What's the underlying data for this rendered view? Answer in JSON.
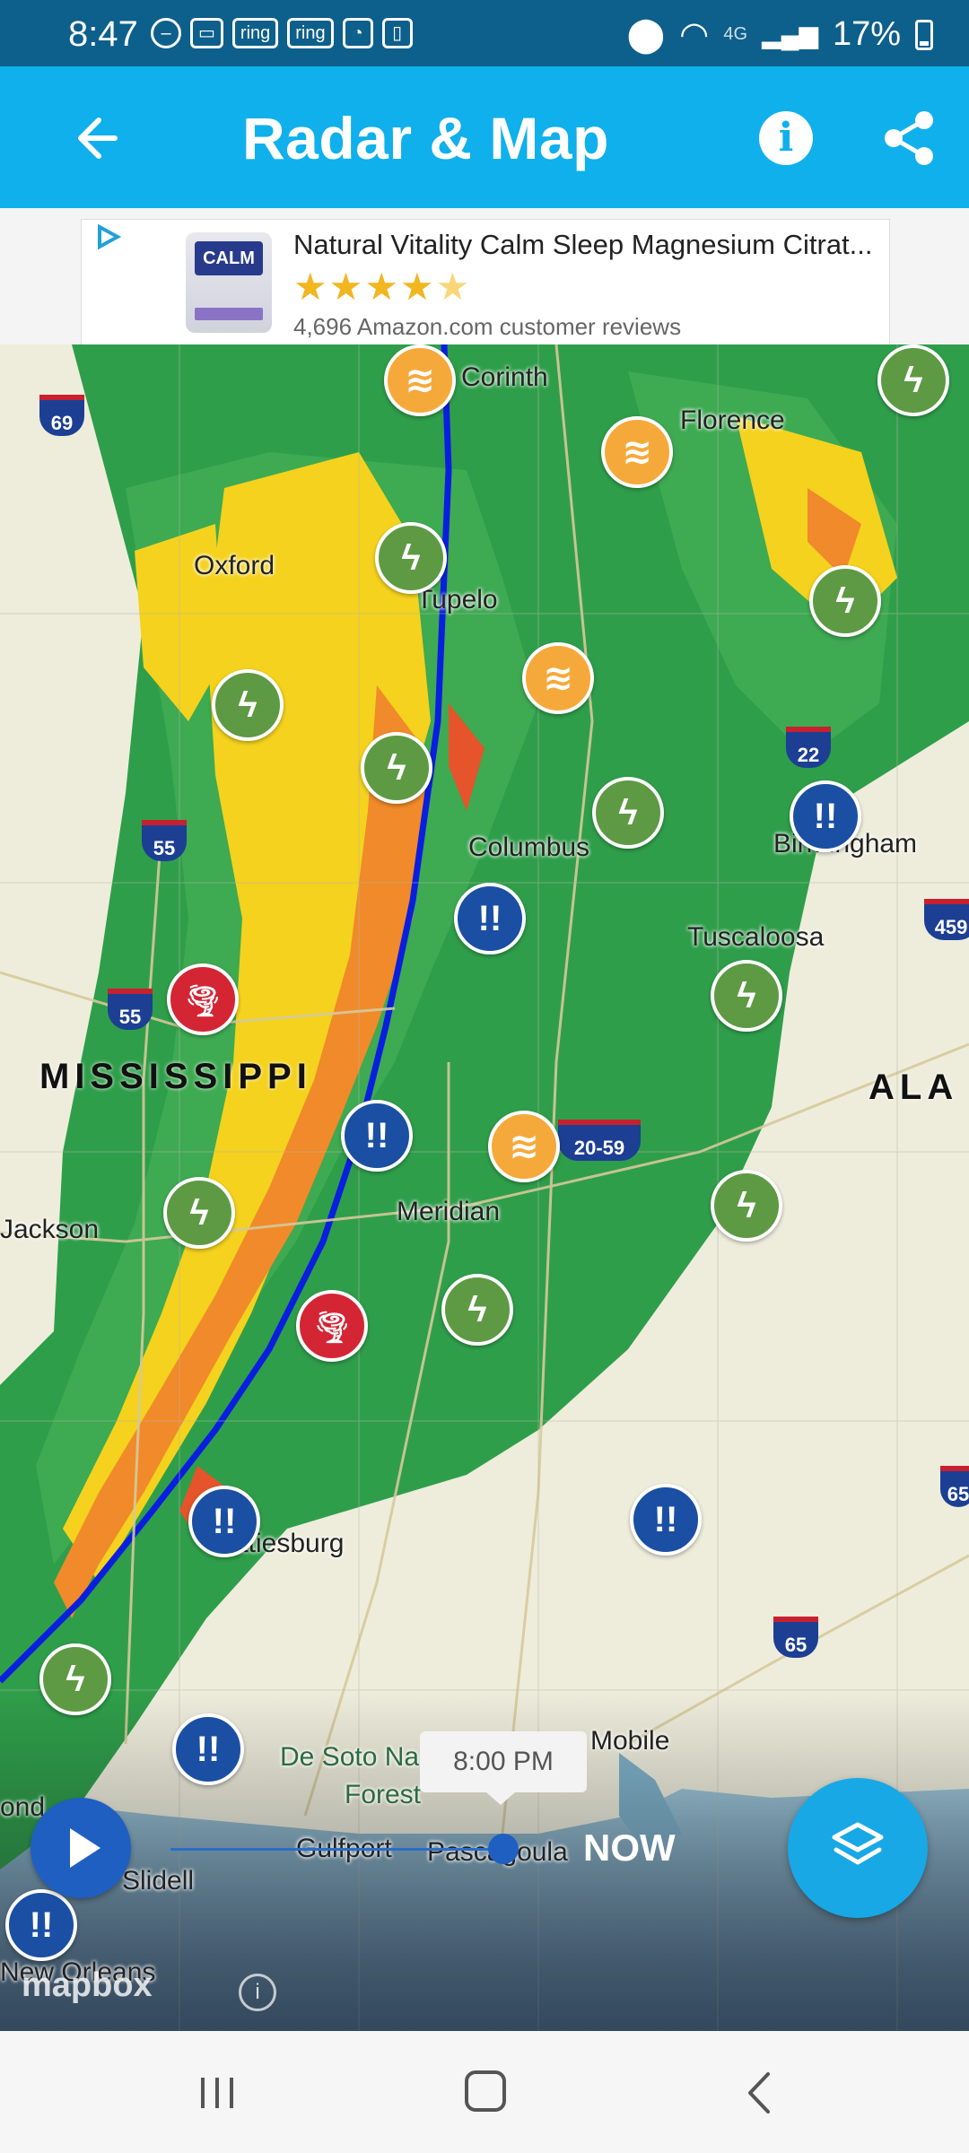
{
  "status_bar": {
    "time": "8:47",
    "chips": [
      "ring",
      "ring"
    ],
    "network": "4G",
    "battery": "17%"
  },
  "app_bar": {
    "title": "Radar & Map",
    "icons": [
      "back-arrow-icon",
      "info-icon",
      "share-icon"
    ]
  },
  "ad": {
    "title": "Natural Vitality Calm Sleep Magnesium Citrat...",
    "product_brand": "CALM",
    "rating_stars": 4.5,
    "stars_text": "★★★★★",
    "reviews": "4,696 Amazon.com customer reviews"
  },
  "map": {
    "state_labels": [
      "MISSISSIPPI",
      "ALA"
    ],
    "cities": {
      "corinth": "Corinth",
      "florence": "Florence",
      "oxford": "Oxford",
      "tupelo": "Tupelo",
      "columbus": "Columbus",
      "birmingham": "Birmingham",
      "tuscaloosa": "Tuscaloosa",
      "meridian": "Meridian",
      "jackson": "Jackson",
      "hattiesburg": "Hattiesburg",
      "desoto": "De Soto Na",
      "forest": "Forest",
      "mobile": "Mobile",
      "gulfport": "Gulfport",
      "pascagoula": "Pascagoula",
      "slidell": "Slidell",
      "neworleans": "New Orleans",
      "pond": "ond"
    },
    "interstates": {
      "i69": "69",
      "i55a": "55",
      "i55b": "55",
      "i22": "22",
      "i459": "459",
      "i2059": "20-59",
      "i65": "65",
      "i65b": "65"
    },
    "marker_glyphs": {
      "storm": "ϟ",
      "wind": "≋",
      "rain": "!!",
      "tornado": "🌪"
    }
  },
  "timeline": {
    "time": "8:00 PM",
    "now_label": "NOW",
    "progress": 0.95
  },
  "attribution": {
    "logo": "mapbox",
    "info": "i"
  },
  "colors": {
    "status_bar": "#0d5f8c",
    "app_bar": "#0fb0ec",
    "radar_green": "#2f9e4a",
    "radar_yellow": "#f4d21e",
    "radar_orange": "#f08a2a",
    "front_line": "#0a1ee0",
    "play_button": "#1f5fc1",
    "layers_button": "#18a8e6"
  }
}
